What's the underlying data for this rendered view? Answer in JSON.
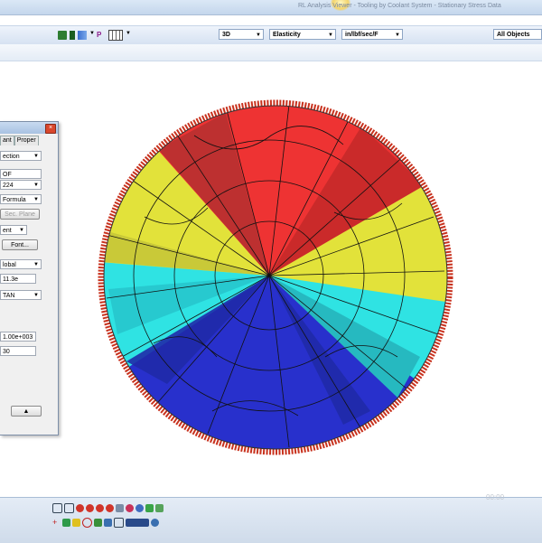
{
  "window": {
    "title": "RL Analysis Viewer - Tooling by Coolant System - Stationary Stress Data"
  },
  "toolbar": {
    "view_combo": "3D",
    "result_combo": "Elasticity",
    "unit_combo": "in/lbf/sec/F",
    "filter_combo": "All Objects",
    "icons": [
      "mesh-icon",
      "section-icon",
      "chart-icon",
      "p-icon",
      "grid-icon"
    ]
  },
  "panel": {
    "tabs": [
      "ant",
      "Proper"
    ],
    "fields": [
      {
        "name": "type-select",
        "value": "ection",
        "dropdown": true
      },
      {
        "name": "dof-field",
        "value": "OF",
        "dropdown": false
      },
      {
        "name": "id-select",
        "value": "224",
        "dropdown": true
      },
      {
        "name": "formula-select",
        "value": "Formula",
        "dropdown": true
      },
      {
        "name": "sec-plane-button",
        "value": "Sec. Plane",
        "button": true,
        "disabled": true
      },
      {
        "name": "component-select",
        "value": "ent",
        "dropdown": true
      },
      {
        "name": "font-button",
        "value": "Font...",
        "button": true
      },
      {
        "name": "coord-select",
        "value": "lobal",
        "dropdown": true
      },
      {
        "name": "max-field",
        "value": "11.3e",
        "dropdown": false
      },
      {
        "name": "scale-select",
        "value": "TAN",
        "dropdown": true
      },
      {
        "name": "min-field",
        "value": "1.00e+003",
        "dropdown": false
      },
      {
        "name": "step-field",
        "value": "30",
        "dropdown": false
      },
      {
        "name": "expand-button",
        "value": "▲",
        "button": true
      }
    ]
  },
  "plot": {
    "colors": {
      "red": "#ee3333",
      "yellow": "#e2e23a",
      "cyan": "#2fe3e3",
      "blue": "#2830cc",
      "edge": "#c8321e"
    }
  },
  "watermark": "00:00"
}
